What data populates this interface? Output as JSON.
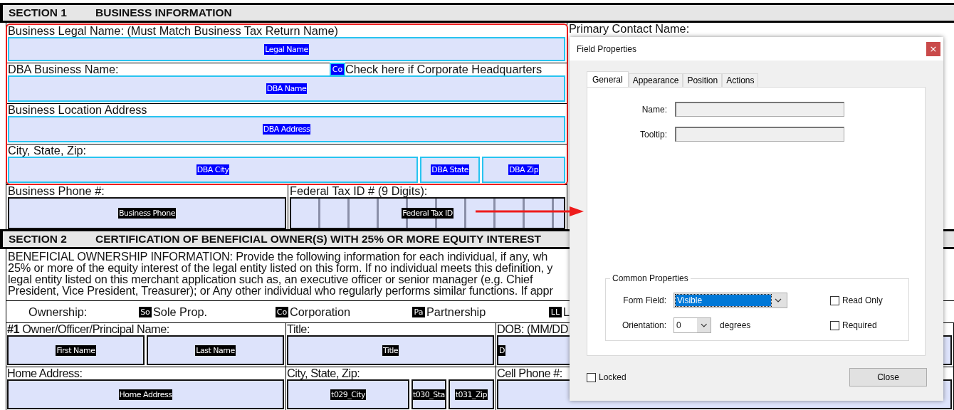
{
  "section_1": {
    "number": "SECTION 1",
    "title": "BUSINESS INFORMATION",
    "right_label": "Primary Contact Name:",
    "rows": [
      {
        "label": "Business Legal Name: (Must Match Business Tax Return Name)",
        "fields": [
          {
            "tag": "Legal Name",
            "selected": true
          }
        ]
      },
      {
        "label": "DBA Business Name:",
        "checkbox": {
          "tag": "Co",
          "label": "Check here if Corporate Headquarters",
          "selected": true
        },
        "fields": [
          {
            "tag": "DBA Name",
            "selected": true
          }
        ]
      },
      {
        "label": "Business Location Address",
        "fields": [
          {
            "tag": "DBA Address",
            "selected": true
          }
        ]
      },
      {
        "label": "City, State, Zip:",
        "fields": [
          {
            "tag": "DBA City",
            "selected": true
          },
          {
            "tag": "DBA State",
            "selected": true
          },
          {
            "tag": "DBA Zip",
            "selected": true
          }
        ]
      }
    ],
    "bottom_cells": [
      {
        "label": "Business Phone #:",
        "fields": [
          {
            "tag": "Business Phone",
            "selected": false,
            "kind": "plain"
          }
        ]
      },
      {
        "label": "Federal Tax ID # (9 Digits):",
        "fields": [
          {
            "tag": "Federal Tax ID",
            "selected": false,
            "kind": "comb"
          }
        ]
      }
    ]
  },
  "section_2": {
    "number": "SECTION 2",
    "title": "CERTIFICATION OF BENEFICIAL OWNER(S) WITH 25% OR MORE EQUITY INTEREST",
    "paragraph": [
      "BENEFICIAL OWNERSHIP INFORMATION: Provide the following information for each individual, if any, wh",
      "25% or more of the equity interest of the legal entity listed on this form. If no individual meets this definition, y",
      "legal entity listed on this merchant application such as, an executive officer or senior manager (e.g. Chief",
      "President, Vice President, Treasurer); or Any other individual who regularly performs similar functions. If appr"
    ],
    "ownership": {
      "label": "Ownership:",
      "options": [
        {
          "tag": "So",
          "label": "Sole Prop."
        },
        {
          "tag": "Co",
          "label": "Corporation"
        },
        {
          "tag": "Pa",
          "label": "Partnership"
        },
        {
          "tag": "LL",
          "label": "L"
        }
      ]
    },
    "rows": [
      [
        {
          "label": "**#1** Owner/Officer/Principal Name:",
          "fields": [
            {
              "tag": "First Name",
              "selected": false,
              "kind": "plain"
            },
            {
              "tag": "Last Name",
              "selected": false,
              "kind": "plain"
            }
          ]
        },
        {
          "label": "Title:",
          "fields": [
            {
              "tag": "Title",
              "selected": false,
              "kind": "plain"
            }
          ]
        },
        {
          "label": "DOB: (MM/DD",
          "fields": [
            {
              "tag": "D",
              "selected": false,
              "kind": "start"
            }
          ]
        }
      ],
      [
        {
          "label": "Home Address:",
          "fields": [
            {
              "tag": "Home Address",
              "selected": false,
              "kind": "plain"
            }
          ]
        },
        {
          "label": "City, State, Zip:",
          "fields": [
            {
              "tag": "t029_City",
              "selected": false,
              "kind": "plain"
            },
            {
              "tag": "t030_Sta",
              "selected": false,
              "kind": "plain"
            },
            {
              "tag": "t031_Zip",
              "selected": false,
              "kind": "plain"
            }
          ]
        },
        {
          "label": "Cell Phone #:",
          "fields": [
            {
              "selected": false,
              "kind": "plain"
            }
          ]
        }
      ]
    ]
  },
  "dialog": {
    "title": "Field Properties",
    "close": "×",
    "tabs": [
      {
        "label": "General",
        "selected": true
      },
      {
        "label": "Appearance",
        "selected": false
      },
      {
        "label": "Position",
        "selected": false
      },
      {
        "label": "Actions",
        "selected": false
      }
    ],
    "fields": [
      {
        "label": "Name:"
      },
      {
        "label": "Tooltip:"
      }
    ],
    "common_properties": {
      "title": "Common Properties",
      "form_field": {
        "label": "Form Field:",
        "value": "Visible"
      },
      "orientation": {
        "label": "Orientation:",
        "value": "0",
        "unit": "degrees"
      },
      "checkboxes": [
        {
          "label": "Read Only",
          "checked": false
        },
        {
          "label": "Required",
          "checked": false
        }
      ]
    },
    "locked": {
      "label": "Locked",
      "checked": false
    },
    "close_button": "Close"
  }
}
